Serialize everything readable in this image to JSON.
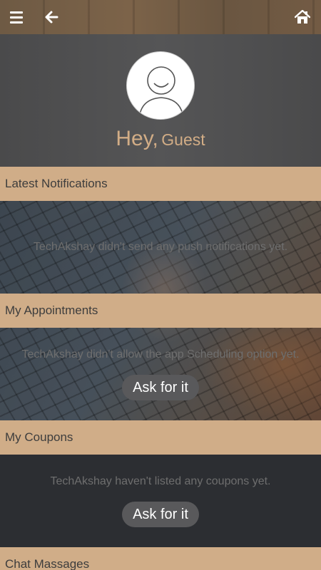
{
  "colors": {
    "section_header_bg": "#d0ad88",
    "greeting_text": "#d2ad86",
    "ask_button_bg": "#59595b",
    "message_text": "#6e6e6e"
  },
  "topbar": {
    "icons": [
      "menu-icon",
      "back-arrow-icon",
      "home-icon"
    ]
  },
  "hero": {
    "greeting": "Hey,",
    "user_name": "Guest",
    "avatar_icon": "user-avatar-icon"
  },
  "notifications": {
    "title": "Latest Notifications",
    "message": "TechAkshay didn't send any push notifications yet."
  },
  "appointments": {
    "title": "My Appointments",
    "message": "TechAkshay didn't allow the app Scheduling option yet.",
    "button": "Ask for it"
  },
  "coupons": {
    "title": "My Coupons",
    "message": "TechAkshay haven't listed any coupons yet.",
    "button": "Ask for it"
  },
  "chat": {
    "title": "Chat Massages"
  }
}
